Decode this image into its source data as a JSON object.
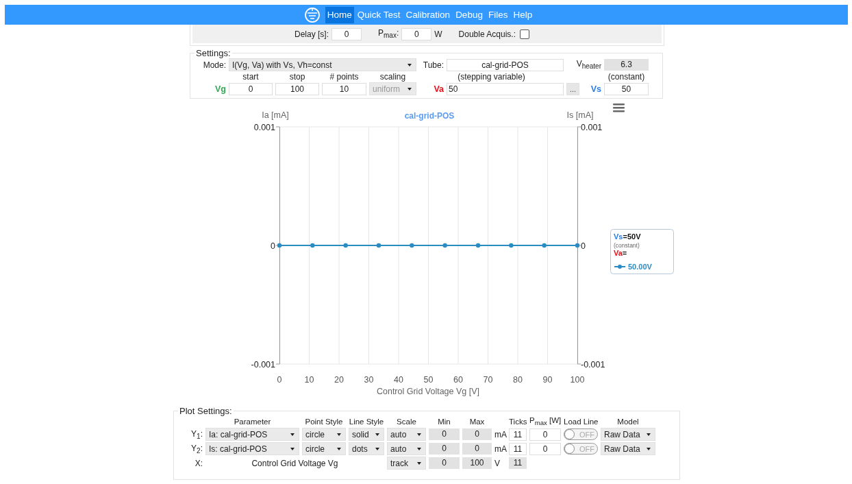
{
  "nav": {
    "items": [
      {
        "label": "Home",
        "selected": true
      },
      {
        "label": "Quick Test",
        "selected": false
      },
      {
        "label": "Calibration",
        "selected": false
      },
      {
        "label": "Debug",
        "selected": false
      },
      {
        "label": "Files",
        "selected": false
      },
      {
        "label": "Help",
        "selected": false
      }
    ]
  },
  "acquisition": {
    "delay_label": "Delay [s]:",
    "delay": "0",
    "pmax_label": "P$_{max}$:",
    "pmax": "0",
    "pmax_unit": "W",
    "double_label": "Double Acquis.:",
    "double_checked": false
  },
  "settings": {
    "title": "Settings:",
    "mode_label": "Mode:",
    "mode": "I(Vg, Va) with Vs, Vh=const",
    "tube_label": "Tube:",
    "tube": "cal-grid-POS",
    "vheater_label": "V$_{heater}$",
    "vheater": "6.3",
    "headers": [
      "start",
      "stop",
      "# points",
      "scaling"
    ],
    "stepping_note": "(stepping variable)",
    "constant_note": "(constant)",
    "sweep": {
      "start": "0",
      "stop": "100",
      "points": "10",
      "scaling": "uniform",
      "scaling_disabled": true
    },
    "variables": [
      {
        "name": "Vg",
        "color": "#33aa55"
      },
      {
        "name": "Va",
        "color": "#e8101a",
        "value": "50"
      },
      {
        "name": "Vs",
        "color": "#2a7de1",
        "value": "50"
      }
    ],
    "more_button": "..."
  },
  "chart": {
    "y2label": "Is [mA]",
    "y2ticks": [
      "0.001",
      "0",
      "-0.001"
    ],
    "legend": {
      "constant_var": "Vs",
      "constant_value": "=50V",
      "note": "(constant)",
      "stepping_var": "Va",
      "stepping_suffix": "="
    },
    "chart_data": {
      "type": "line",
      "title": "cal-grid-POS",
      "xlabel": "Control Grid Voltage Vg [V]",
      "ylabel": "Ia [mA]",
      "x": [
        0,
        11.11,
        22.22,
        33.33,
        44.44,
        55.56,
        66.67,
        77.78,
        88.89,
        100
      ],
      "series": [
        {
          "name": "50.00V",
          "color": "#2b8cc4",
          "marker": "circle",
          "values": [
            0,
            0,
            0,
            0,
            0,
            0,
            0,
            0,
            0,
            0
          ]
        }
      ],
      "xlim": [
        0,
        100
      ],
      "ylim": [
        -0.001,
        0.001
      ],
      "xticks": [
        0,
        10,
        20,
        30,
        40,
        50,
        60,
        70,
        80,
        90,
        100
      ],
      "yticks": [
        {
          "value": -0.001,
          "label": "-0.001"
        },
        {
          "value": 0,
          "label": "0"
        },
        {
          "value": 0.001,
          "label": "0.001"
        }
      ],
      "grid": true
    }
  },
  "plot_settings": {
    "title": "Plot Settings:",
    "headers": [
      "Parameter",
      "Point Style",
      "Line Style",
      "Scale",
      "Min",
      "Max",
      "Ticks",
      "P$_{max}$ [W]",
      "Load Line",
      "Model"
    ],
    "rows": [
      {
        "label": "Y$_{1}$:",
        "parameter": "Ia: cal-grid-POS",
        "point_style": "circle",
        "line_style": "solid",
        "scale": "auto",
        "min": "0",
        "max": "0",
        "unit": "mA",
        "ticks": "11",
        "pmax": "0",
        "load_line": {
          "on": false,
          "label": "OFF"
        },
        "model": "Raw Data"
      },
      {
        "label": "Y$_{2}$:",
        "parameter": "Is: cal-grid-POS",
        "point_style": "circle",
        "line_style": "dots",
        "scale": "auto",
        "min": "0",
        "max": "0",
        "unit": "mA",
        "ticks": "11",
        "pmax": "0",
        "load_line": {
          "on": false,
          "label": "OFF"
        },
        "model": "Raw Data"
      }
    ],
    "x_row": {
      "label": "X:",
      "parameter": "Control Grid Voltage Vg",
      "scale": "track",
      "min": "0",
      "max": "100",
      "unit": "V",
      "ticks": "11"
    }
  }
}
